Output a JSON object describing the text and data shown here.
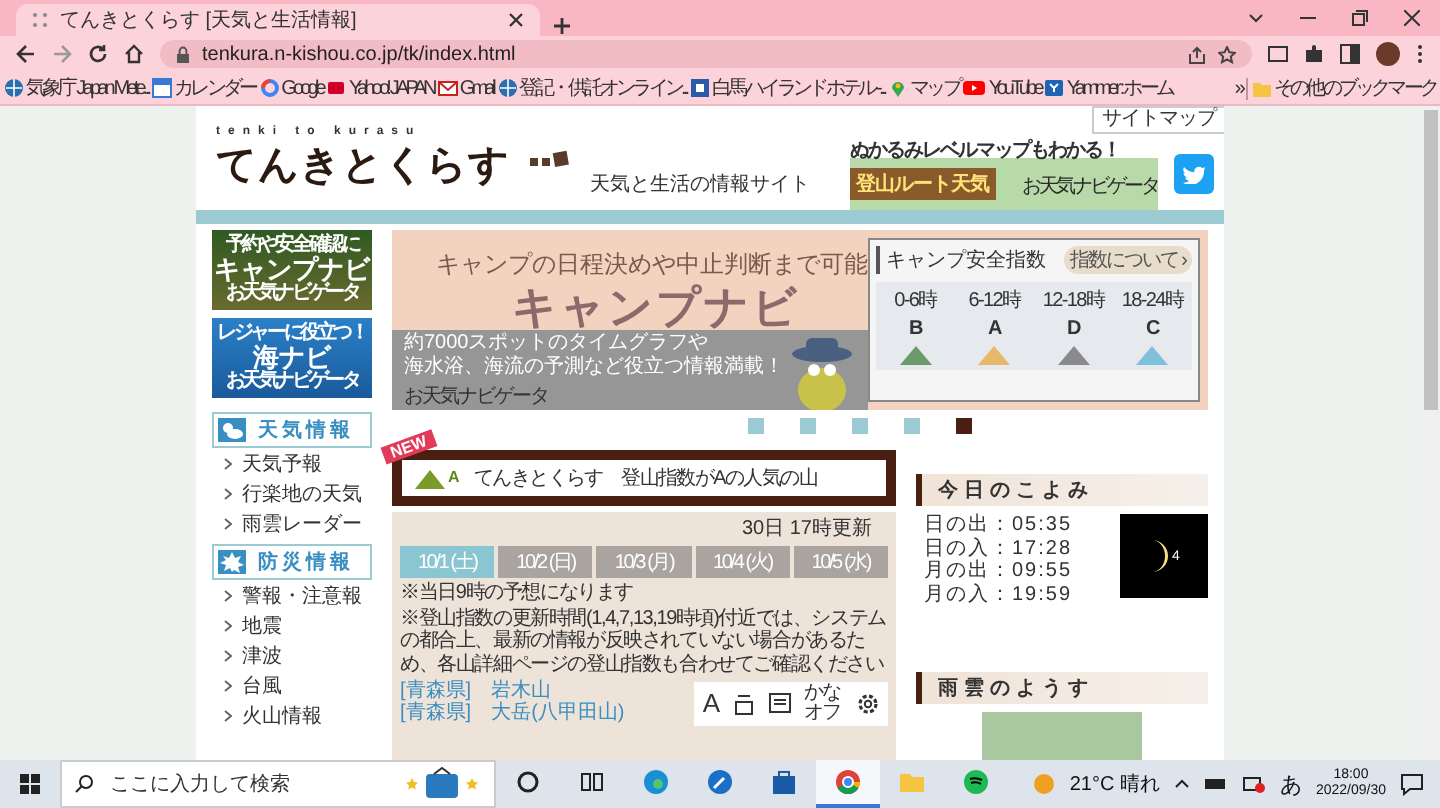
{
  "browser": {
    "tab_title": "てんきとくらす [天気と生活情報]",
    "url": "tenkura.n-kishou.co.jp/tk/index.html",
    "bookmarks": [
      {
        "label": "気象庁 Japan Mete...",
        "kind": "globe"
      },
      {
        "label": "カレンダー",
        "kind": "calendar"
      },
      {
        "label": "Google",
        "kind": "ring"
      },
      {
        "label": "Yahoo! JAPAN",
        "kind": "yahoo"
      },
      {
        "label": "Gmail",
        "kind": "mail"
      },
      {
        "label": "登記・供託オンライン...",
        "kind": "globe"
      },
      {
        "label": "白馬ハイランドホテル -...",
        "kind": "hotel"
      },
      {
        "label": "マップ",
        "kind": "pin"
      },
      {
        "label": "YouTube",
        "kind": "play"
      },
      {
        "label": "Yammer : ホーム",
        "kind": "yammer"
      }
    ],
    "more": "»",
    "other_bookmarks": "その他のブックマーク"
  },
  "site": {
    "sitemap_link": "サイトマップ",
    "logo_romaji": "tenki to kurasu",
    "logo": "てんきとくらす",
    "tagline": "天気と生活の情報サイト",
    "promo_caption": "ぬかるみレベルマップもわかる！",
    "promo_sign": "登山ルート天気",
    "promo_brand": "お天気ナビゲータ"
  },
  "sidebar": {
    "banners": [
      {
        "kind": "camp",
        "caption": "予約や安全確認に",
        "title": "キャンプナビ",
        "brand": "お天気ナビゲータ"
      },
      {
        "kind": "sea",
        "caption": "レジャーに役立つ！",
        "title": "海ナビ",
        "brand": "お天気ナビゲータ"
      }
    ],
    "sections": [
      {
        "kind": "weather",
        "title": "天気情報",
        "items": [
          "天気予報",
          "行楽地の天気",
          "雨雲レーダー"
        ]
      },
      {
        "kind": "disaster",
        "title": "防災情報",
        "items": [
          "警報・注意報",
          "地震",
          "津波",
          "台風",
          "火山情報"
        ]
      }
    ]
  },
  "carousel": {
    "headline": "キャンプの日程決めや中止判断まで可能",
    "title": "キャンプナビ",
    "body": [
      "約7000スポットのタイムグラフや",
      "海水浴、海流の予測など役立つ情報満載！"
    ],
    "brand": "お天気ナビゲータ",
    "index_panel": {
      "title": "キャンプ安全指数",
      "button": "指数について ›",
      "slots": [
        {
          "time": "0-6時",
          "grade": "B",
          "color": "#6a9a6a"
        },
        {
          "time": "6-12時",
          "grade": "A",
          "color": "#e8b86a"
        },
        {
          "time": "12-18時",
          "grade": "D",
          "color": "#8a8a8a"
        },
        {
          "time": "18-24時",
          "grade": "C",
          "color": "#7fc0dc"
        }
      ]
    },
    "dots": [
      {
        "selected": false
      },
      {
        "selected": false
      },
      {
        "selected": false
      },
      {
        "selected": false
      },
      {
        "selected": true
      }
    ]
  },
  "feature": {
    "badge": "NEW",
    "icon_grade": "A",
    "title": "てんきとくらす　登山指数がAの人気の山",
    "updated": "30日 17時更新",
    "days": [
      {
        "label": "10/1 (土)",
        "selected": true
      },
      {
        "label": "10/2 (日)",
        "selected": false
      },
      {
        "label": "10/3 (月)",
        "selected": false
      },
      {
        "label": "10/4 (火)",
        "selected": false
      },
      {
        "label": "10/5 (水)",
        "selected": false
      }
    ],
    "notes": [
      "※当日9時の予想になります",
      "※登山指数の更新時間(1,4,7,13,19時頃)付近では、システムの都合上、最新の情報が反映されていない場合があるため、各山詳細ページの登山指数も合わせてご確認ください"
    ],
    "mountains": [
      {
        "pref": "[青森県]",
        "name": "岩木山"
      },
      {
        "pref": "[青森県]",
        "name": "大岳(八甲田山)"
      }
    ],
    "tools": [
      {
        "kind": "text",
        "label": "A"
      },
      {
        "kind": "ruby"
      },
      {
        "kind": "reader"
      },
      {
        "kind": "kana",
        "label": "かなオフ"
      },
      {
        "kind": "settings"
      }
    ]
  },
  "koyomi": {
    "title": "今日のこよみ",
    "rows": [
      {
        "label": "日の出：",
        "value": "05:35"
      },
      {
        "label": "日の入：",
        "value": "17:28"
      },
      {
        "label": "月の出：",
        "value": "09:55"
      },
      {
        "label": "月の入：",
        "value": "19:59"
      }
    ],
    "moon_age": "4"
  },
  "radar": {
    "title": "雨雲のようす"
  },
  "taskbar": {
    "search_placeholder": "ここに入力して検索",
    "apps": [
      {
        "kind": "cortana",
        "selected": false
      },
      {
        "kind": "taskview",
        "selected": false
      },
      {
        "kind": "edge",
        "selected": false
      },
      {
        "kind": "tool",
        "selected": false
      },
      {
        "kind": "store",
        "selected": false
      },
      {
        "kind": "chrome",
        "selected": true
      },
      {
        "kind": "folder",
        "selected": false
      },
      {
        "kind": "spotify",
        "selected": false
      }
    ],
    "weather": "21°C 晴れ",
    "ime": "あ",
    "time": "18:00",
    "date": "2022/09/30"
  }
}
